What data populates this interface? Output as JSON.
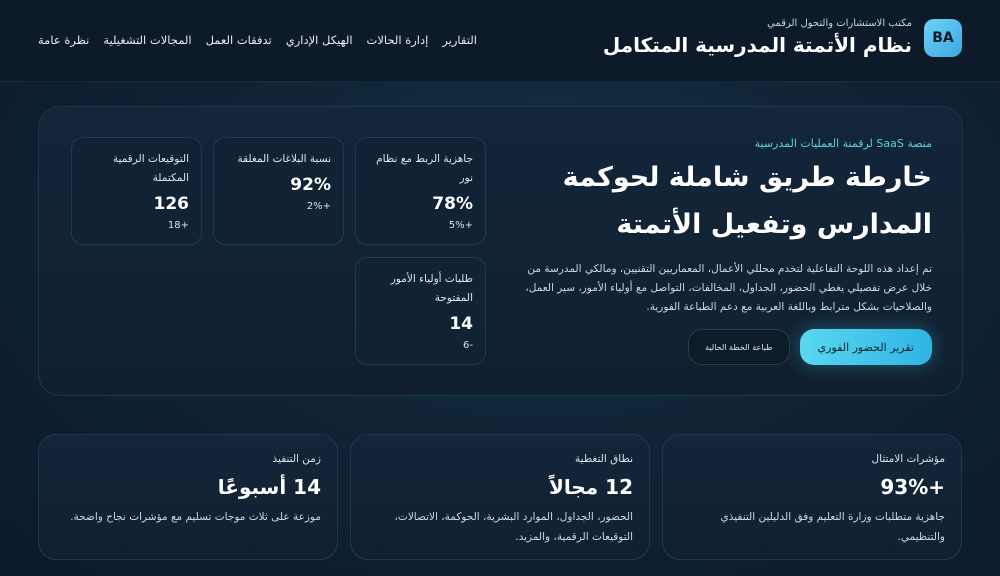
{
  "header": {
    "logo": "BA",
    "subtitle": "مكتب الاستشارات والتحول الرقمي",
    "title": "نظام الأتمتة المدرسية المتكامل",
    "nav": [
      "نظرة عامة",
      "المجالات التشغيلية",
      "تدفقات العمل",
      "الهيكل الإداري",
      "إدارة الحالات",
      "التقارير"
    ]
  },
  "hero": {
    "eyebrow": "منصة SaaS لرقمنة العمليات المدرسية",
    "title_line1": "خارطة طريق شاملة لحوكمة",
    "title_line2": "المدارس وتفعيل الأتمتة",
    "description": "تم إعداد هذه اللوحة التفاعلية لتخدم محللي الأعمال، المعماريين التقنيين، ومالكي المدرسة من خلال عرض تفصيلي يغطي الحضور، الجداول، المخالفات، التواصل مع أولياء الأمور، سير العمل، والصلاحيات بشكل مترابط وباللغة العربية مع دعم الطباعة الفورية.",
    "primary_button": "تقرير الحضور الفوري",
    "secondary_button": "طباعة الخطة الحالية"
  },
  "stats": [
    {
      "label": "جاهزية الربط مع نظام نور",
      "value": "78%",
      "delta": "+5%"
    },
    {
      "label": "نسبة البلاغات المغلقة",
      "value": "92%",
      "delta": "+2%"
    },
    {
      "label": "التوقيعات الرقمية المكتملة",
      "value": "126",
      "delta": "+18"
    },
    {
      "label": "طلبات أولياء الأمور المفتوحة",
      "value": "14",
      "delta": "-6"
    }
  ],
  "kpis": [
    {
      "label": "مؤشرات الامتثال",
      "value": "+93%",
      "description": "جاهزية متطلبات وزارة التعليم وفق الدليلين التنفيذي والتنظيمي."
    },
    {
      "label": "نطاق التغطية",
      "value": "12 مجالاً",
      "description": "الحضور، الجداول، الموارد البشرية، الحوكمة، الاتصالات، التوقيعات الرقمية، والمزيد."
    },
    {
      "label": "زمن التنفيذ",
      "value": "14 أسبوعًا",
      "description": "موزعة على ثلاث موجات تسليم مع مؤشرات نجاح واضحة."
    }
  ],
  "colors": {
    "background": "#0f2435",
    "accent": "#4fcdef",
    "eyebrow": "#5ed0d8",
    "card": "#112235"
  }
}
